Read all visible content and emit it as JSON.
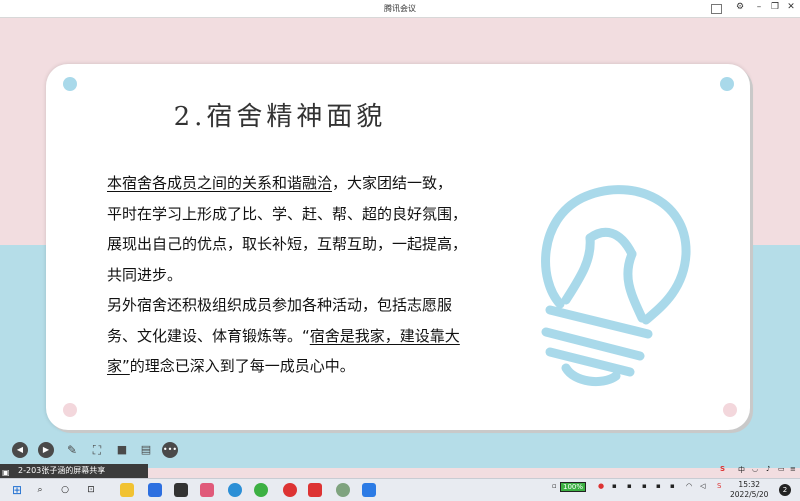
{
  "window": {
    "title": "腾讯会议"
  },
  "slide": {
    "title": "2.宿舍精神面貌",
    "paragraph1": {
      "underlined": "本宿舍各成员之间的关系和谐融洽",
      "rest": "，大家团结一致，平时在学习上形成了比、学、赶、帮、超的良好氛围，展现出自己的优点，取长补短，互帮互助，一起提高，共同进步。"
    },
    "paragraph2": {
      "before": "另外宿舍还积极组织成员参加各种活动，包括志愿服务、文化建设、体育锻炼等。“",
      "underlined": "宿舍是我家，建设靠大家”",
      "after": "的理念已深入到了每一成员心中。"
    },
    "colors": {
      "pink_bg": "#f2dde0",
      "blue_bg": "#b5dde8",
      "bulb": "#a9d9ea"
    }
  },
  "controls": [
    "prev-icon",
    "next-icon",
    "pen-icon",
    "screen-icon",
    "camera-icon",
    "chat-icon",
    "more-icon"
  ],
  "share_bar": {
    "label": "2-203张子涵的屏幕共享"
  },
  "taskbar": {
    "battery": "100%",
    "ime": "中",
    "time": "15:32",
    "date": "2022/5/20",
    "notifications": "2"
  }
}
